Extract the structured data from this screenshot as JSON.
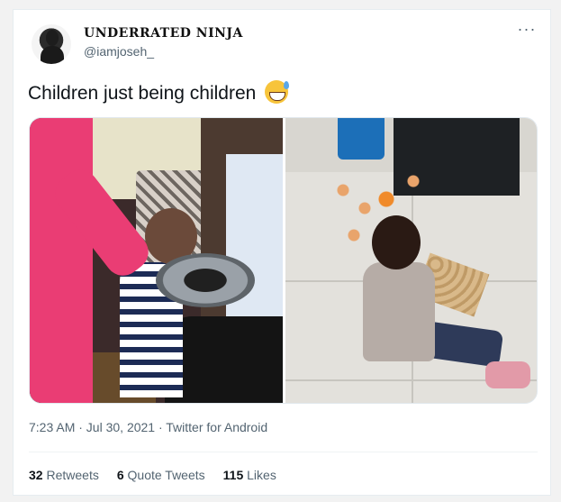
{
  "author": {
    "display_name": "UNDERRATED NINJA",
    "handle": "@iamjoseh_",
    "avatar_icon": "profile-avatar"
  },
  "menu": {
    "more_label": "···"
  },
  "tweet": {
    "text": "Children just being children",
    "emoji": "grinning-face-with-sweat-emoji"
  },
  "media": {
    "count": 2,
    "photos": [
      "photo-child-with-pot",
      "photo-child-with-broken-eggs"
    ]
  },
  "meta": {
    "timestamp": "7:23 AM · Jul 30, 2021 · Twitter for Android"
  },
  "stats": {
    "retweets_count": "32",
    "retweets_label": "Retweets",
    "quotes_count": "6",
    "quotes_label": "Quote Tweets",
    "likes_count": "115",
    "likes_label": "Likes"
  },
  "colors": {
    "text_primary": "#0f1419",
    "text_secondary": "#536471",
    "border": "#e6ecf0"
  }
}
